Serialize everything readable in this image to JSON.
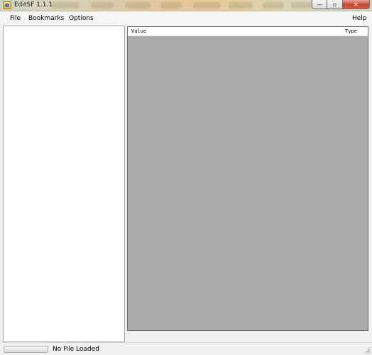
{
  "window": {
    "title": "EditSF 1.1.1",
    "buttons": {
      "minimize": "—",
      "maximize": "▫",
      "close": "✕"
    }
  },
  "menu": {
    "left_items": [
      "File",
      "Bookmarks",
      "Options"
    ],
    "help": "Help"
  },
  "list_view": {
    "columns": [
      "Value",
      "Type"
    ],
    "background_color": "#ababab"
  },
  "status": {
    "progress_percent": 0,
    "text": "No File Loaded"
  },
  "icons": [
    "app-icon",
    "minimize-icon",
    "maximize-icon",
    "close-icon",
    "resize-grip-icon"
  ]
}
